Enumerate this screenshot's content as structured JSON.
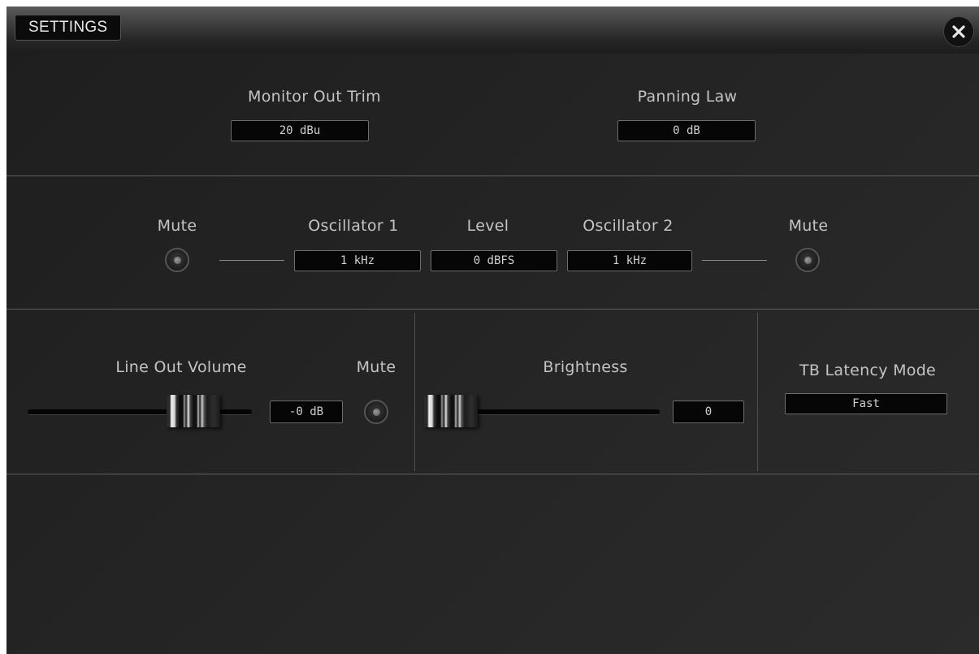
{
  "window": {
    "title": "SETTINGS"
  },
  "top": {
    "monitor_out_trim": {
      "label": "Monitor Out Trim",
      "value": "20 dBu"
    },
    "panning_law": {
      "label": "Panning Law",
      "value": "0 dB"
    }
  },
  "oscillator": {
    "mute_left_label": "Mute",
    "osc1_label": "Oscillator 1",
    "osc1_value": "1 kHz",
    "level_label": "Level",
    "level_value": "0 dBFS",
    "osc2_label": "Oscillator 2",
    "osc2_value": "1 kHz",
    "mute_right_label": "Mute"
  },
  "line_out": {
    "label": "Line Out Volume",
    "value": "-0 dB",
    "mute_label": "Mute",
    "fader_level": 0.82
  },
  "brightness": {
    "label": "Brightness",
    "value": "0",
    "fader_level": 0.0
  },
  "tb_latency": {
    "label": "TB Latency Mode",
    "value": "Fast"
  },
  "icons": {
    "close": "close-icon",
    "mute": "mute-button-icon"
  }
}
